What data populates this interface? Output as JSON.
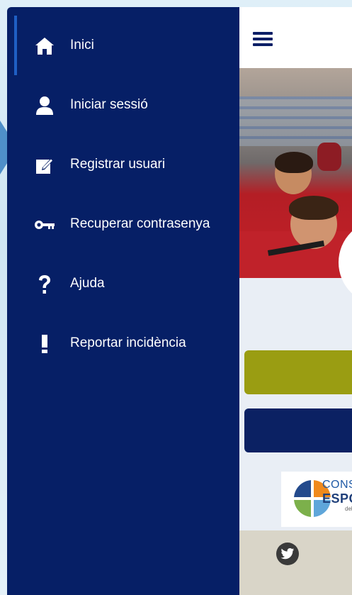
{
  "drawer": {
    "items": [
      {
        "label": "Inici",
        "icon": "home-icon"
      },
      {
        "label": "Iniciar sessió",
        "icon": "user-icon"
      },
      {
        "label": "Registrar usuari",
        "icon": "edit-icon"
      },
      {
        "label": "Recuperar contrasenya",
        "icon": "key-icon"
      },
      {
        "label": "Ajuda",
        "icon": "question-icon"
      },
      {
        "label": "Reportar incidència",
        "icon": "exclamation-icon"
      }
    ],
    "active_index": 0
  },
  "app": {
    "menu_icon": "hamburger-icon",
    "logo": {
      "text_line1": "CONSI",
      "text_line2": "ESPO",
      "text_line3": "del"
    },
    "footer_icon": "twitter-icon"
  },
  "colors": {
    "drawer_bg": "#061f66",
    "olive_button": "#9a9d12",
    "navy_button": "#0b2163",
    "accent": "#1f5fc4"
  }
}
